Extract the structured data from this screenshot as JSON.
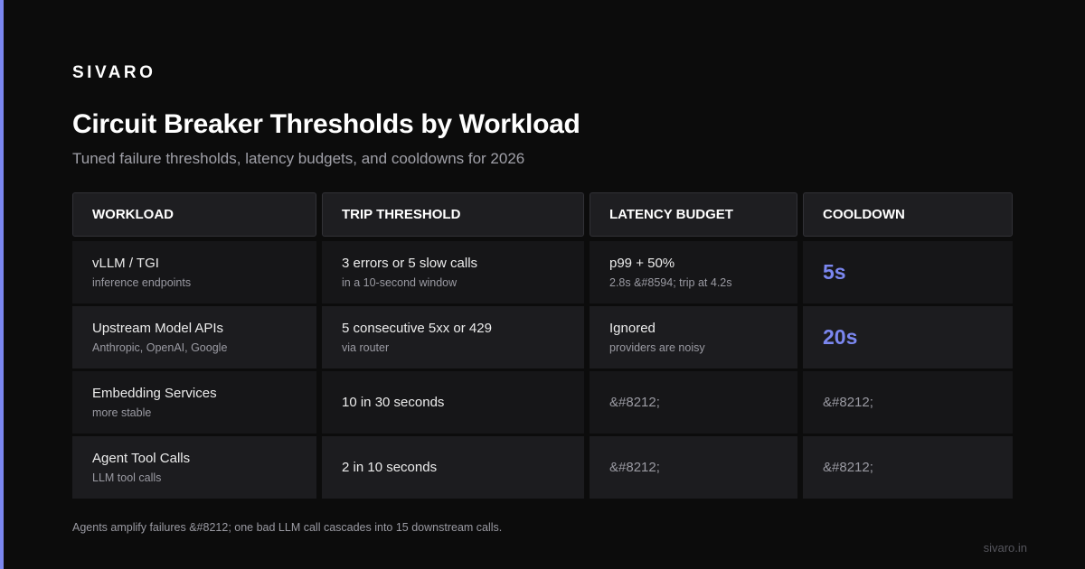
{
  "brand": "SIVARO",
  "title": "Circuit Breaker Thresholds by Workload",
  "subtitle": "Tuned failure thresholds, latency budgets, and cooldowns for 2026",
  "columns": [
    "WORKLOAD",
    "TRIP THRESHOLD",
    "LATENCY BUDGET",
    "COOLDOWN"
  ],
  "rows": [
    {
      "workload": "vLLM / TGI",
      "workload_sub": "inference endpoints",
      "trip": "3 errors or 5 slow calls",
      "trip_sub": "in a 10-second window",
      "latency": "p99 + 50%",
      "latency_sub": "2.8s &#8594; trip at 4.2s",
      "cooldown": "5s"
    },
    {
      "workload": "Upstream Model APIs",
      "workload_sub": "Anthropic, OpenAI, Google",
      "trip": "5 consecutive 5xx or 429",
      "trip_sub": "via router",
      "latency": "Ignored",
      "latency_sub": "providers are noisy",
      "cooldown": "20s"
    },
    {
      "workload": "Embedding Services",
      "workload_sub": "more stable",
      "trip": "10 in 30 seconds",
      "trip_sub": "",
      "latency": "&#8212;",
      "latency_sub": "",
      "cooldown": "&#8212;"
    },
    {
      "workload": "Agent Tool Calls",
      "workload_sub": "LLM tool calls",
      "trip": "2 in 10 seconds",
      "trip_sub": "",
      "latency": "&#8212;",
      "latency_sub": "",
      "cooldown": "&#8212;"
    }
  ],
  "footnote": "Agents amplify failures &#8212; one bad LLM call cascades into 15 downstream calls.",
  "site": "sivaro.in",
  "colors": {
    "accent": "#7b87f0",
    "background": "#0c0c0c"
  }
}
